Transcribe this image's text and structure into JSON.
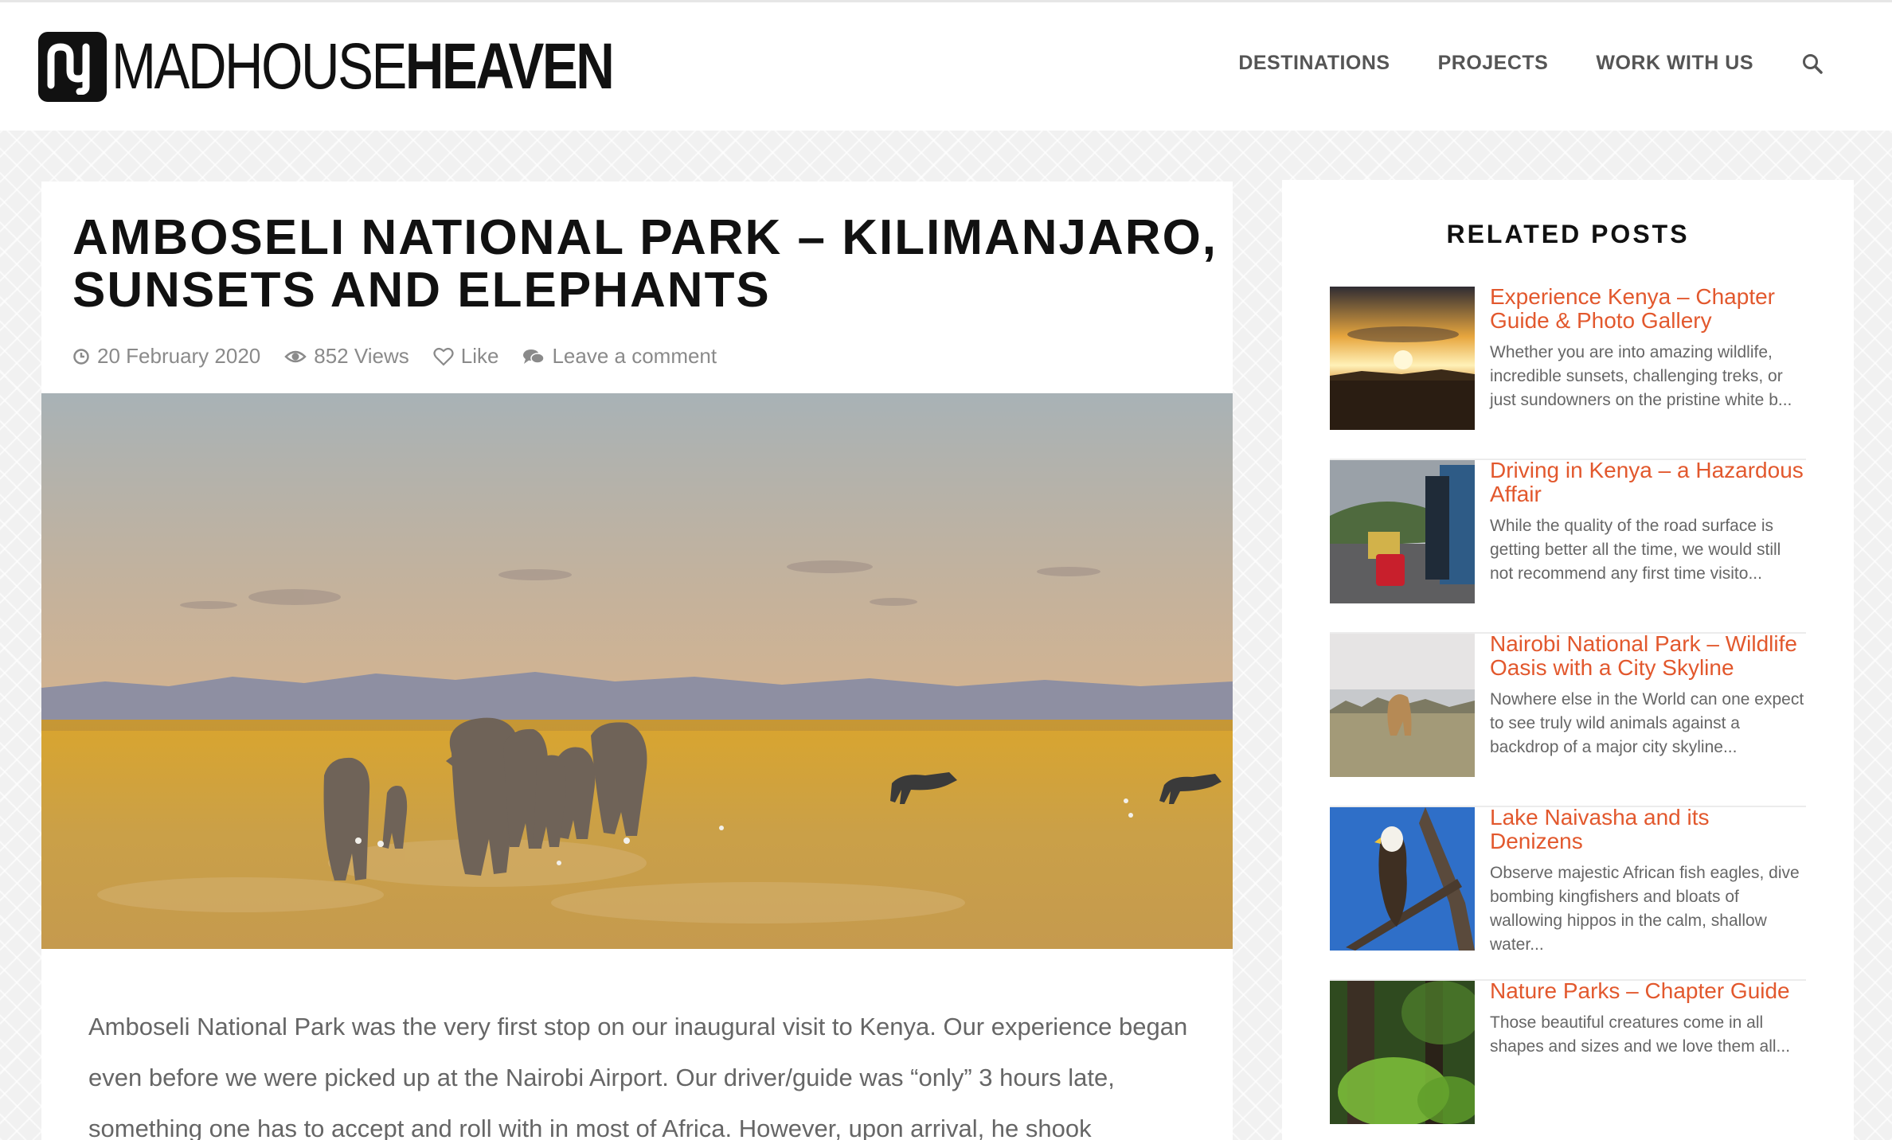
{
  "site": {
    "logo_thin": "MADHOUSE",
    "logo_bold": "HEAVEN"
  },
  "nav": {
    "items": [
      "DESTINATIONS",
      "PROJECTS",
      "WORK WITH US"
    ],
    "search_icon": "search-icon"
  },
  "article": {
    "title": "AMBOSELI NATIONAL PARK – KILIMANJARO, SUNSETS AND ELEPHANTS",
    "date": "20 February 2020",
    "views": "852 Views",
    "like": "Like",
    "comment": "Leave a comment",
    "body": "Amboseli National Park was the very first stop on our inaugural visit to Kenya. Our experience began even before we were picked up at the Nairobi Airport. Our driver/guide was “only” 3 hours late, something one has to accept and roll with in most of Africa. However, upon arrival, he shook"
  },
  "sidebar": {
    "title": "RELATED POSTS",
    "posts": [
      {
        "title": "Experience Kenya – Chapter Guide & Photo Gallery",
        "excerpt": "Whether you are into amazing wildlife, incredible sunsets, challenging treks, or just sundowners on the pristine white b..."
      },
      {
        "title": "Driving in Kenya – a Hazardous Affair",
        "excerpt": "While the quality of the road surface is getting better all the time, we would still not recommend any first time visito..."
      },
      {
        "title": "Nairobi National Park – Wildlife Oasis with a City Skyline",
        "excerpt": "Nowhere else in the World can one expect to see truly wild animals against a backdrop of a major city skyline..."
      },
      {
        "title": "Lake Naivasha and its Denizens",
        "excerpt": "Observe majestic African fish eagles, dive bombing kingfishers and bloats of wallowing hippos in the calm, shallow water..."
      },
      {
        "title": "Nature Parks – Chapter Guide",
        "excerpt": "Those beautiful creatures come in all shapes and sizes and we love them all..."
      }
    ]
  },
  "colors": {
    "accent": "#e2582d",
    "text": "#333333",
    "meta": "#8a8a8a"
  }
}
